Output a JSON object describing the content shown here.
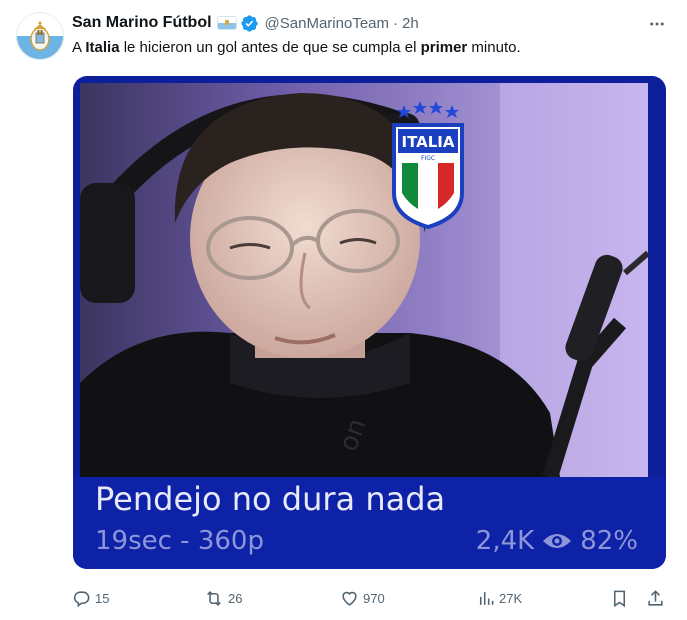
{
  "account": {
    "display_name": "San Marino Fútbol",
    "handle": "@SanMarinoTeam",
    "separator": "·",
    "time": "2h",
    "verified": true
  },
  "tweet": {
    "text_parts": [
      "A ",
      "Italia",
      " le hicieron un gol antes de que se cumpla el ",
      "primer",
      " minuto."
    ]
  },
  "media": {
    "badge_text": "ITALIA",
    "badge_sub": "FIGC",
    "caption_title": "Pendejo no dura nada",
    "caption_meta": "19sec - 360p",
    "caption_views": "2,4K",
    "caption_percent": "82%"
  },
  "actions": {
    "replies": "15",
    "retweets": "26",
    "likes": "970",
    "views": "27K"
  },
  "colors": {
    "accent": "#1d9bf0",
    "muted": "#536471",
    "media_frame": "#0e22a8",
    "italia_blue": "#1a3fbf"
  },
  "icons": [
    "more-icon",
    "verified-icon",
    "reply-icon",
    "retweet-icon",
    "like-icon",
    "views-icon",
    "bookmark-icon",
    "share-icon",
    "eye-icon"
  ]
}
